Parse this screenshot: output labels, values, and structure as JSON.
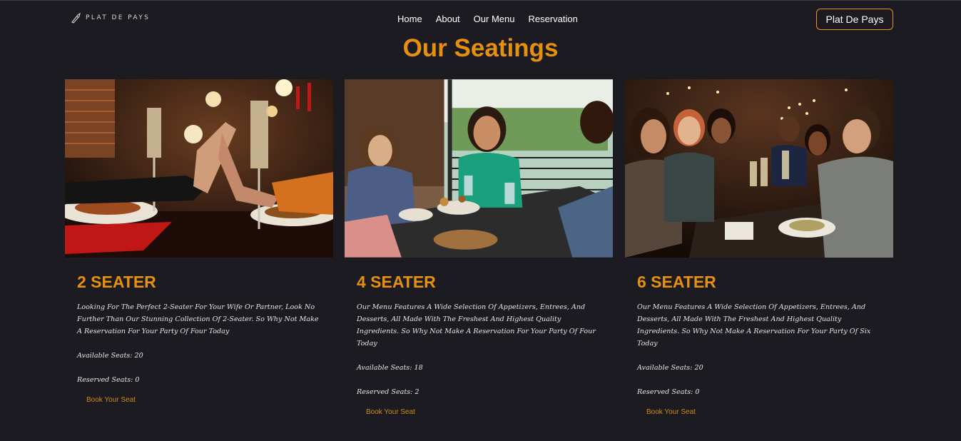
{
  "header": {
    "brand": "PLAT DE PAYS",
    "nav": [
      "Home",
      "About",
      "Our Menu",
      "Reservation"
    ],
    "cta_label": "Plat De Pays"
  },
  "page": {
    "title": "Our Seatings"
  },
  "cards": [
    {
      "heading": "2 SEATER",
      "description": "Looking For The Perfect 2-Seater For Your Wife Or Partner, Look No Further Than Our Stunning Collection Of 2-Seater. So Why Not Make A Reservation For Your Party Of Four Today",
      "available": "Available Seats: 20",
      "reserved": "Reserved Seats: 0",
      "book_label": "Book Your Seat"
    },
    {
      "heading": "4 SEATER",
      "description": "Our Menu Features A Wide Selection Of Appetizers, Entrees, And Desserts, All Made With The Freshest And Highest Quality Ingredients. So Why Not Make A Reservation For Your Party Of Four Today",
      "available": "Available Seats: 18",
      "reserved": "Reserved Seats: 2",
      "book_label": "Book Your Seat"
    },
    {
      "heading": "6 SEATER",
      "description": "Our Menu Features A Wide Selection Of Appetizers, Entrees, And Desserts, All Made With The Freshest And Highest Quality Ingredients. So Why Not Make A Reservation For Your Party Of Six Today",
      "available": "Available Seats: 20",
      "reserved": "Reserved Seats: 0",
      "book_label": "Book Your Seat"
    }
  ],
  "colors": {
    "background": "#1b1b21",
    "accent": "#e5900e",
    "text": "#e6e6e6"
  },
  "icons": {
    "brand": "chef-knife-icon"
  }
}
